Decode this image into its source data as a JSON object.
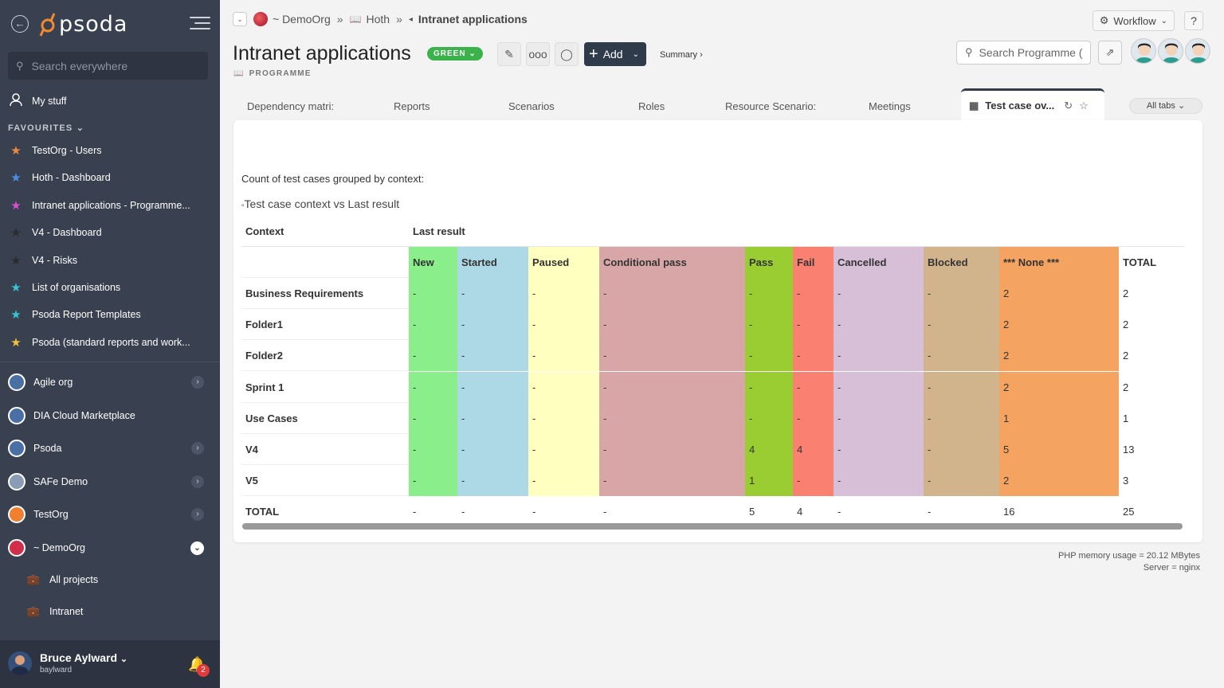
{
  "sidebar": {
    "logo": "psoda",
    "search_placeholder": "Search everywhere",
    "my_stuff": "My stuff",
    "favourites_heading": "FAVOURITES",
    "favourites": [
      {
        "label": "TestOrg - Users",
        "color": "#f08a3c"
      },
      {
        "label": "Hoth - Dashboard",
        "color": "#4a90e2"
      },
      {
        "label": "Intranet applications - Programme...",
        "color": "#d94fd0"
      },
      {
        "label": "V4 - Dashboard",
        "color": "#2b2b2b"
      },
      {
        "label": "V4 - Risks",
        "color": "#2b2b2b"
      },
      {
        "label": "List of organisations",
        "color": "#39c2d7"
      },
      {
        "label": "Psoda Report Templates",
        "color": "#39c2d7"
      },
      {
        "label": "Psoda (standard reports and work...",
        "color": "#f2c23c"
      }
    ],
    "orgs": [
      {
        "label": "Agile org",
        "has_chevron": true
      },
      {
        "label": "DIA Cloud Marketplace",
        "has_chevron": false
      },
      {
        "label": "Psoda",
        "has_chevron": true
      },
      {
        "label": "SAFe Demo",
        "has_chevron": true
      },
      {
        "label": "TestOrg",
        "has_chevron": true
      },
      {
        "label": "~ DemoOrg",
        "expanded": true
      }
    ],
    "sub_items": [
      "All projects",
      "Intranet"
    ],
    "user": {
      "name": "Bruce Aylward",
      "username": "baylward",
      "notifications": "2"
    }
  },
  "breadcrumb": {
    "org": "~ DemoOrg",
    "parent": "Hoth",
    "current": "Intranet applications"
  },
  "header": {
    "workflow_label": "Workflow",
    "help_label": "?",
    "title": "Intranet applications",
    "status": "GREEN",
    "type": "PROGRAMME",
    "add_label": "Add",
    "summary_label": "Summary ›",
    "search_placeholder": "Search Programme (",
    "status_color": "#3bb34a"
  },
  "tabs": [
    "Dependency matri:",
    "Reports",
    "Scenarios",
    "Roles",
    "Resource Scenario:",
    "Meetings"
  ],
  "active_tab": "Test case ov...",
  "all_tabs_label": "All tabs",
  "report": {
    "caption": "Count of test cases grouped by context:",
    "image_alt": "Test case context vs Last result",
    "context_header": "Context",
    "last_result_header": "Last result",
    "columns": [
      {
        "label": "New",
        "color": "#8aef8a"
      },
      {
        "label": "Started",
        "color": "#add8e6"
      },
      {
        "label": "Paused",
        "color": "#ffffbf"
      },
      {
        "label": "Conditional pass",
        "color": "#d8a6a6"
      },
      {
        "label": "Pass",
        "color": "#9acd32"
      },
      {
        "label": "Fail",
        "color": "#fa8072"
      },
      {
        "label": "Cancelled",
        "color": "#d8bfd8"
      },
      {
        "label": "Blocked",
        "color": "#d2b48c"
      },
      {
        "label": "*** None ***",
        "color": "#f4a460"
      },
      {
        "label": "TOTAL",
        "color": "#ffffff"
      }
    ],
    "rows": [
      {
        "context": "Business Requirements",
        "values": [
          "-",
          "-",
          "-",
          "-",
          "-",
          "-",
          "-",
          "-",
          "2",
          "2"
        ]
      },
      {
        "context": "Folder1",
        "values": [
          "-",
          "-",
          "-",
          "-",
          "-",
          "-",
          "-",
          "-",
          "2",
          "2"
        ]
      },
      {
        "context": "Folder2",
        "values": [
          "-",
          "-",
          "-",
          "-",
          "-",
          "-",
          "-",
          "-",
          "2",
          "2"
        ]
      },
      {
        "context": "Sprint 1",
        "values": [
          "-",
          "-",
          "-",
          "-",
          "-",
          "-",
          "-",
          "-",
          "2",
          "2"
        ]
      },
      {
        "context": "Use Cases",
        "values": [
          "-",
          "-",
          "-",
          "-",
          "-",
          "-",
          "-",
          "-",
          "1",
          "1"
        ]
      },
      {
        "context": "V4",
        "values": [
          "-",
          "-",
          "-",
          "-",
          "4",
          "4",
          "-",
          "-",
          "5",
          "13"
        ]
      },
      {
        "context": "V5",
        "values": [
          "-",
          "-",
          "-",
          "-",
          "1",
          "-",
          "-",
          "-",
          "2",
          "3"
        ]
      }
    ],
    "total_row": {
      "context": "TOTAL",
      "values": [
        "-",
        "-",
        "-",
        "-",
        "5",
        "4",
        "-",
        "-",
        "16",
        "25"
      ]
    }
  },
  "footer": {
    "memory": "PHP memory usage = 20.12 MBytes",
    "server": "Server = nginx"
  }
}
